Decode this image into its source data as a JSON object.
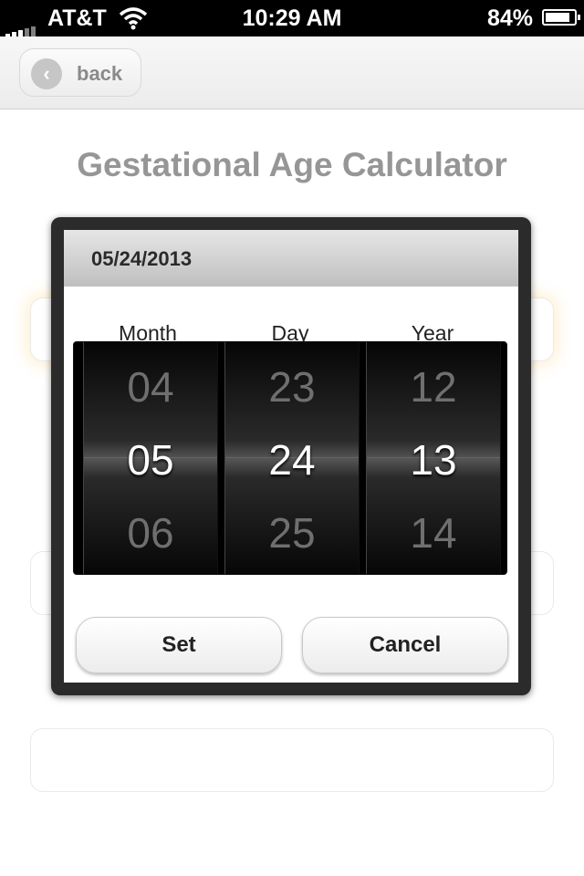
{
  "status_bar": {
    "carrier": "AT&T",
    "time": "10:29 AM",
    "battery": "84%"
  },
  "nav": {
    "back_label": "back"
  },
  "page": {
    "title": "Gestational Age Calculator"
  },
  "date_picker": {
    "header_date": "05/24/2013",
    "columns": {
      "month": {
        "label": "Month",
        "prev": "04",
        "selected": "05",
        "next": "06"
      },
      "day": {
        "label": "Day",
        "prev": "23",
        "selected": "24",
        "next": "25"
      },
      "year": {
        "label": "Year",
        "prev": "12",
        "selected": "13",
        "next": "14"
      }
    },
    "set_label": "Set",
    "cancel_label": "Cancel"
  }
}
